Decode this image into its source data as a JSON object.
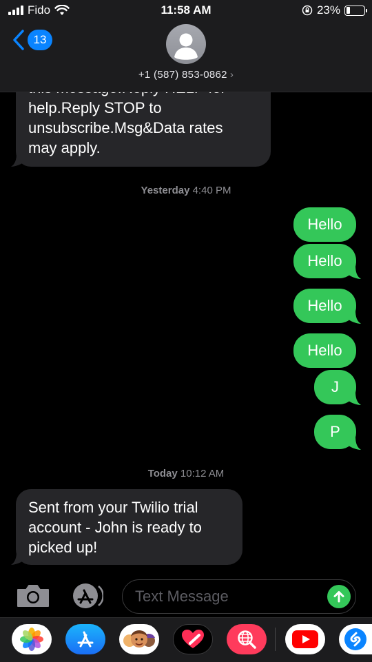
{
  "status_bar": {
    "carrier": "Fido",
    "time": "11:58 AM",
    "battery": "23%",
    "battery_level": 0.23
  },
  "header": {
    "back_badge": "13",
    "contact_number": "+1 (587) 853-0862",
    "contact_chevron": "›"
  },
  "messages": {
    "partial_top": "this message.Reply HELP for help.Reply STOP to unsubscribe.Msg&Data rates may apply.",
    "partial_top_lines": [
      "this message.Reply HELP for",
      "help.Reply STOP to",
      "unsubscribe.Msg&Data rates",
      "may apply."
    ],
    "ts1_day": "Yesterday",
    "ts1_time": "4:40 PM",
    "outgoing": [
      "Hello",
      "Hello",
      "Hello",
      "Hello",
      "J",
      "P"
    ],
    "ts2_day": "Today",
    "ts2_time": "10:12 AM",
    "incoming_lines": [
      "Sent from your Twilio trial",
      "account - John is ready to",
      "picked up!"
    ]
  },
  "compose": {
    "placeholder": "Text Message"
  },
  "colors": {
    "outgoing": "#34c759",
    "incoming": "#262629",
    "accent": "#0a84ff"
  },
  "drawer_icons": [
    "photos-icon",
    "app-store-icon",
    "memoji-icon",
    "digital-touch-icon",
    "search-images-icon",
    "youtube-icon",
    "shazam-icon"
  ]
}
